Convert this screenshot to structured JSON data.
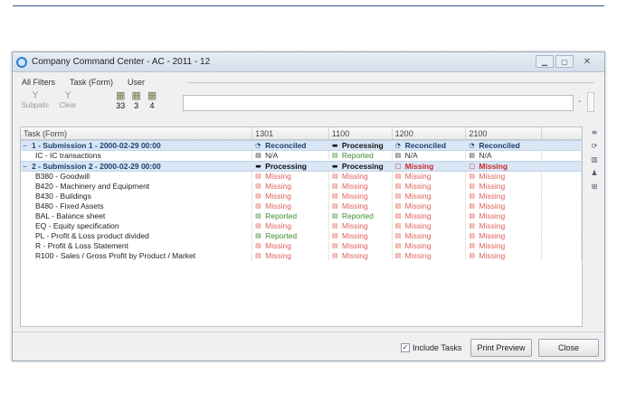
{
  "window": {
    "title": "Company Command Center - AC - 2011 - 12",
    "buttons": {
      "minimize": "▁",
      "maximize": "▢",
      "close": "✕"
    }
  },
  "filters": {
    "tabs": [
      "All Filters",
      "Task (Form)",
      "User"
    ],
    "tools": [
      {
        "icon": "filter-funnel-icon",
        "glyph": "Y",
        "label": "Subpatic"
      },
      {
        "icon": "clear-filter-icon",
        "glyph": "Y",
        "label": "Clear"
      }
    ],
    "counts": [
      {
        "icon": "reports-icon",
        "value": "33"
      },
      {
        "icon": "reports-icon",
        "value": "3"
      },
      {
        "icon": "reports-icon",
        "value": "4"
      }
    ],
    "search_value": "",
    "dash": "-"
  },
  "grid": {
    "headers": [
      "Task (Form)",
      "1301",
      "1100",
      "1200",
      "2100"
    ],
    "rows": [
      {
        "type": "group",
        "expander": "−",
        "name": "1 - Submission 1 - 2000-02-29 00:00",
        "cells": [
          {
            "status": "reconciled",
            "icon": "◔",
            "text": "Reconciled"
          },
          {
            "status": "processing",
            "icon": "▬",
            "text": "Processing"
          },
          {
            "status": "reconciled",
            "icon": "◔",
            "text": "Reconciled"
          },
          {
            "status": "reconciled",
            "icon": "◔",
            "text": "Reconciled"
          }
        ]
      },
      {
        "type": "task",
        "name": "IC - IC transactions",
        "cells": [
          {
            "status": "na",
            "icon": "▤",
            "text": "N/A"
          },
          {
            "status": "reported",
            "icon": "▤",
            "text": "Reported"
          },
          {
            "status": "na",
            "icon": "▤",
            "text": "N/A"
          },
          {
            "status": "na",
            "icon": "▤",
            "text": "N/A"
          }
        ]
      },
      {
        "type": "group",
        "expander": "−",
        "name": "2 - Submission 2 - 2000-02-29 00:00",
        "cells": [
          {
            "status": "processing",
            "icon": "▬",
            "text": "Processing"
          },
          {
            "status": "processing",
            "icon": "▬",
            "text": "Processing"
          },
          {
            "status": "missing-bold",
            "icon": "□",
            "text": "Missing"
          },
          {
            "status": "missing-bold",
            "icon": "□",
            "text": "Missing"
          }
        ]
      },
      {
        "type": "task",
        "name": "B380 - Goodwill",
        "cells": [
          {
            "status": "missing",
            "icon": "▤",
            "text": "Missing"
          },
          {
            "status": "missing",
            "icon": "▤",
            "text": "Missing"
          },
          {
            "status": "missing",
            "icon": "▤",
            "text": "Missing"
          },
          {
            "status": "missing",
            "icon": "▤",
            "text": "Missing"
          }
        ]
      },
      {
        "type": "task",
        "name": "B420 - Machinery and Equipment",
        "cells": [
          {
            "status": "missing",
            "icon": "▤",
            "text": "Missing"
          },
          {
            "status": "missing",
            "icon": "▤",
            "text": "Missing"
          },
          {
            "status": "missing",
            "icon": "▤",
            "text": "Missing"
          },
          {
            "status": "missing",
            "icon": "▤",
            "text": "Missing"
          }
        ]
      },
      {
        "type": "task",
        "name": "B430 - Buildings",
        "cells": [
          {
            "status": "missing",
            "icon": "▤",
            "text": "Missing"
          },
          {
            "status": "missing",
            "icon": "▤",
            "text": "Missing"
          },
          {
            "status": "missing",
            "icon": "▤",
            "text": "Missing"
          },
          {
            "status": "missing",
            "icon": "▤",
            "text": "Missing"
          }
        ]
      },
      {
        "type": "task",
        "name": "B480 - Fixed Assets",
        "cells": [
          {
            "status": "missing",
            "icon": "▤",
            "text": "Missing"
          },
          {
            "status": "missing",
            "icon": "▤",
            "text": "Missing"
          },
          {
            "status": "missing",
            "icon": "▤",
            "text": "Missing"
          },
          {
            "status": "missing",
            "icon": "▤",
            "text": "Missing"
          }
        ]
      },
      {
        "type": "task",
        "name": "BAL - Balance sheet",
        "cells": [
          {
            "status": "reported",
            "icon": "▤",
            "text": "Reported"
          },
          {
            "status": "reported",
            "icon": "▤",
            "text": "Reported"
          },
          {
            "status": "missing",
            "icon": "▤",
            "text": "Missing"
          },
          {
            "status": "missing",
            "icon": "▤",
            "text": "Missing"
          }
        ]
      },
      {
        "type": "task",
        "name": "EQ - Equity specification",
        "cells": [
          {
            "status": "missing",
            "icon": "▤",
            "text": "Missing"
          },
          {
            "status": "missing",
            "icon": "▤",
            "text": "Missing"
          },
          {
            "status": "missing",
            "icon": "▤",
            "text": "Missing"
          },
          {
            "status": "missing",
            "icon": "▤",
            "text": "Missing"
          }
        ]
      },
      {
        "type": "task",
        "name": "PL - Profit & Loss product divided",
        "cells": [
          {
            "status": "reported",
            "icon": "▤",
            "text": "Reported"
          },
          {
            "status": "missing",
            "icon": "▤",
            "text": "Missing"
          },
          {
            "status": "missing",
            "icon": "▤",
            "text": "Missing"
          },
          {
            "status": "missing",
            "icon": "▤",
            "text": "Missing"
          }
        ]
      },
      {
        "type": "task",
        "name": "R - Profit & Loss Statement",
        "cells": [
          {
            "status": "missing",
            "icon": "▤",
            "text": "Missing"
          },
          {
            "status": "missing",
            "icon": "▤",
            "text": "Missing"
          },
          {
            "status": "missing",
            "icon": "▤",
            "text": "Missing"
          },
          {
            "status": "missing",
            "icon": "▤",
            "text": "Missing"
          }
        ]
      },
      {
        "type": "task",
        "name": "R100 - Sales / Gross Profit by Product / Market",
        "cells": [
          {
            "status": "missing",
            "icon": "▤",
            "text": "Missing"
          },
          {
            "status": "missing",
            "icon": "▤",
            "text": "Missing"
          },
          {
            "status": "missing",
            "icon": "▤",
            "text": "Missing"
          },
          {
            "status": "missing",
            "icon": "▤",
            "text": "Missing"
          }
        ]
      }
    ]
  },
  "side_icons": [
    {
      "name": "collapse-icon",
      "glyph": "≡"
    },
    {
      "name": "refresh-icon",
      "glyph": "⟳"
    },
    {
      "name": "chart-icon",
      "glyph": "▥"
    },
    {
      "name": "user-icon",
      "glyph": "♟"
    },
    {
      "name": "export-icon",
      "glyph": "⊞"
    }
  ],
  "bottom": {
    "include_tasks_label": "Include Tasks",
    "include_tasks_checked": true,
    "print_preview_label": "Print Preview",
    "close_label": "Close"
  },
  "colors": {
    "missing": "#e2605a",
    "reported": "#3c8a2f",
    "reconciled": "#1c3f6e",
    "group_bg": "#d8e6f5"
  }
}
